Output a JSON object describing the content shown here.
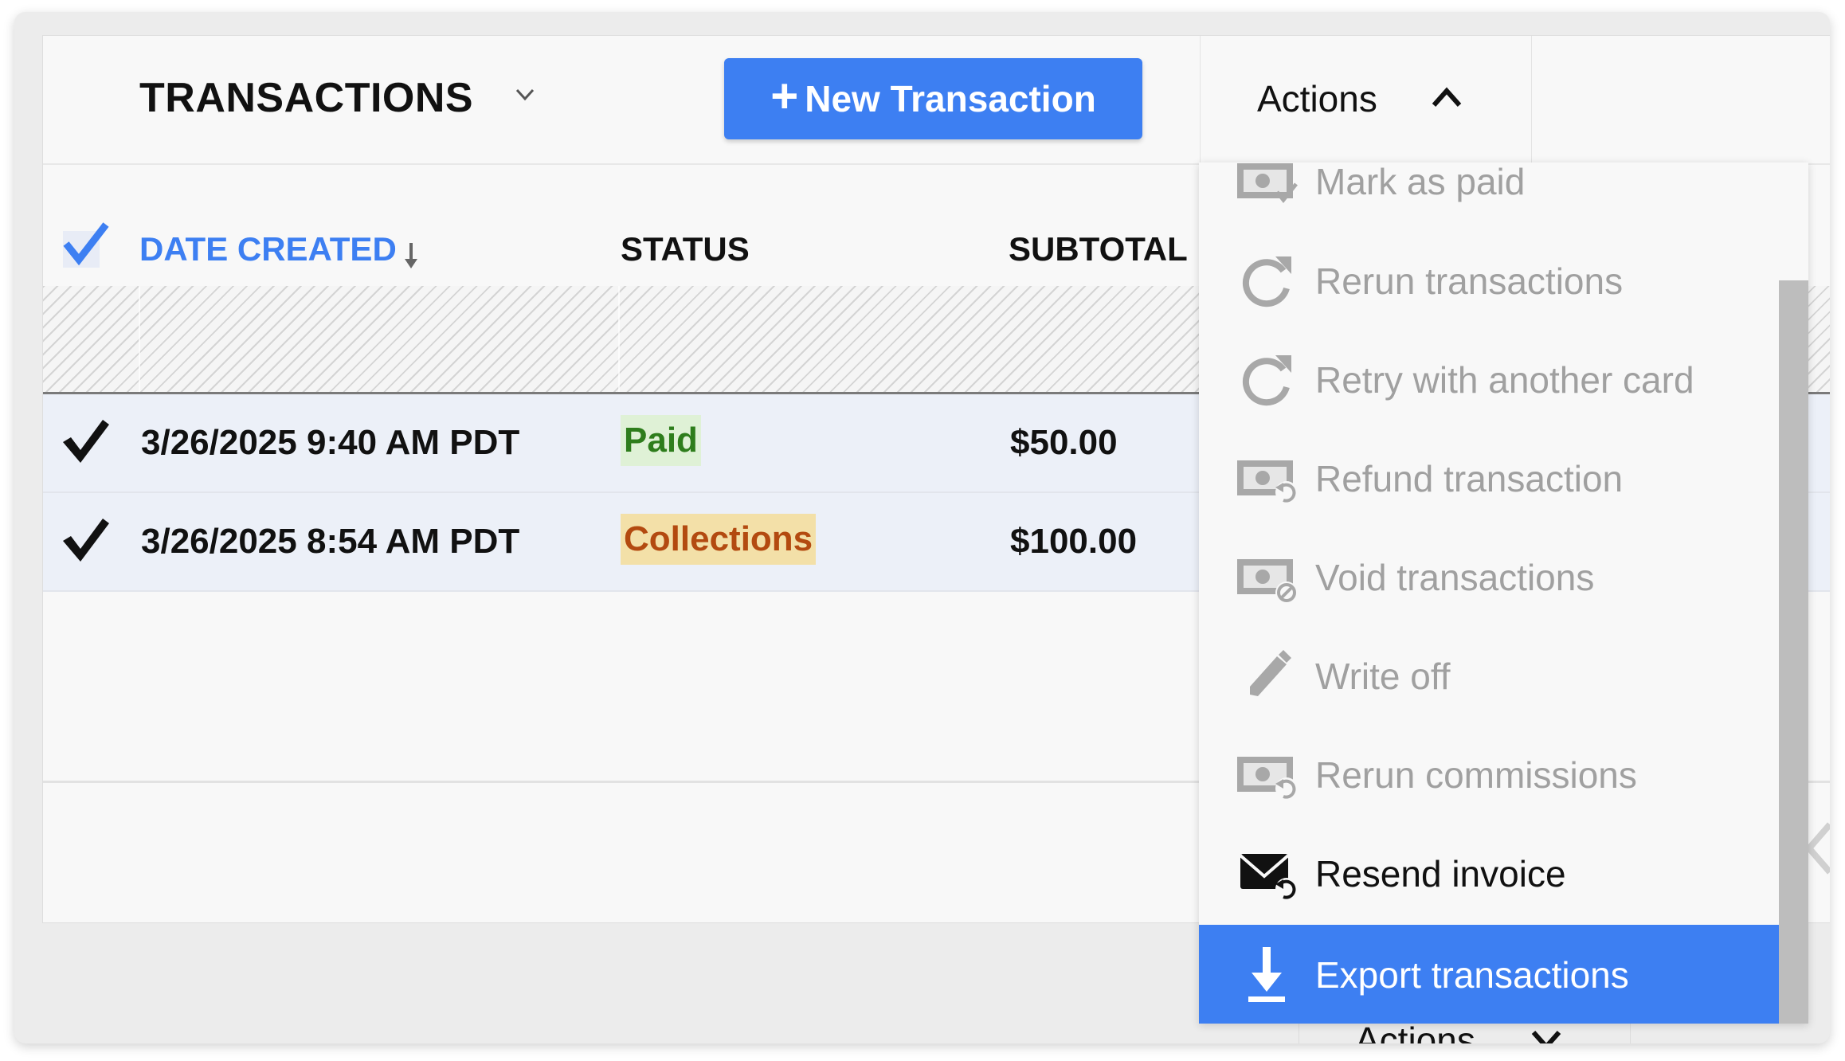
{
  "header": {
    "title": "TRANSACTIONS",
    "title_dropdown_icon": "chevron-down-icon",
    "new_button": {
      "icon": "plus-icon",
      "label": "New Transaction"
    },
    "actions": {
      "label": "Actions",
      "icon": "chevron-up-icon",
      "expanded": true
    }
  },
  "table": {
    "select_all_checked": true,
    "columns": [
      {
        "label": "DATE CREATED",
        "sorted": "descending",
        "sort_icon": "arrow-down-icon",
        "active": true
      },
      {
        "label": "STATUS"
      },
      {
        "label": "SUBTOTAL"
      }
    ],
    "rows": [
      {
        "selected": true,
        "date": "3/26/2025 9:40 AM PDT",
        "status": "Paid",
        "subtotal": "$50.00"
      },
      {
        "selected": true,
        "date": "3/26/2025 8:54 AM PDT",
        "status": "Collections",
        "subtotal": "$100.00"
      }
    ]
  },
  "actions_menu": {
    "items": [
      {
        "label": "Mark as paid",
        "icon": "money-check-icon",
        "enabled": false
      },
      {
        "label": "Rerun transactions",
        "icon": "redo-icon",
        "enabled": false
      },
      {
        "label": "Retry with another card",
        "icon": "redo-icon",
        "enabled": false
      },
      {
        "label": "Refund transaction",
        "icon": "money-refund-icon",
        "enabled": false
      },
      {
        "label": "Void transactions",
        "icon": "money-void-icon",
        "enabled": false
      },
      {
        "label": "Write off",
        "icon": "pencil-icon",
        "enabled": false
      },
      {
        "label": "Rerun commissions",
        "icon": "money-refund-icon",
        "enabled": false
      },
      {
        "label": "Resend invoice",
        "icon": "envelope-resend-icon",
        "enabled": true
      },
      {
        "label": "Export transactions",
        "icon": "download-icon",
        "enabled": true,
        "highlighted": true
      }
    ]
  },
  "footer": {
    "actions_label": "Actions",
    "icon": "chevron-down-icon"
  },
  "colors": {
    "accent": "#3d7ff2",
    "paid_bg": "#dff1d6",
    "paid_text": "#2e7d1c",
    "collections_bg": "#f3e0a8",
    "collections_text": "#b34a10",
    "selected_row": "#ecf0f8",
    "disabled_text": "#a0a0a0"
  }
}
